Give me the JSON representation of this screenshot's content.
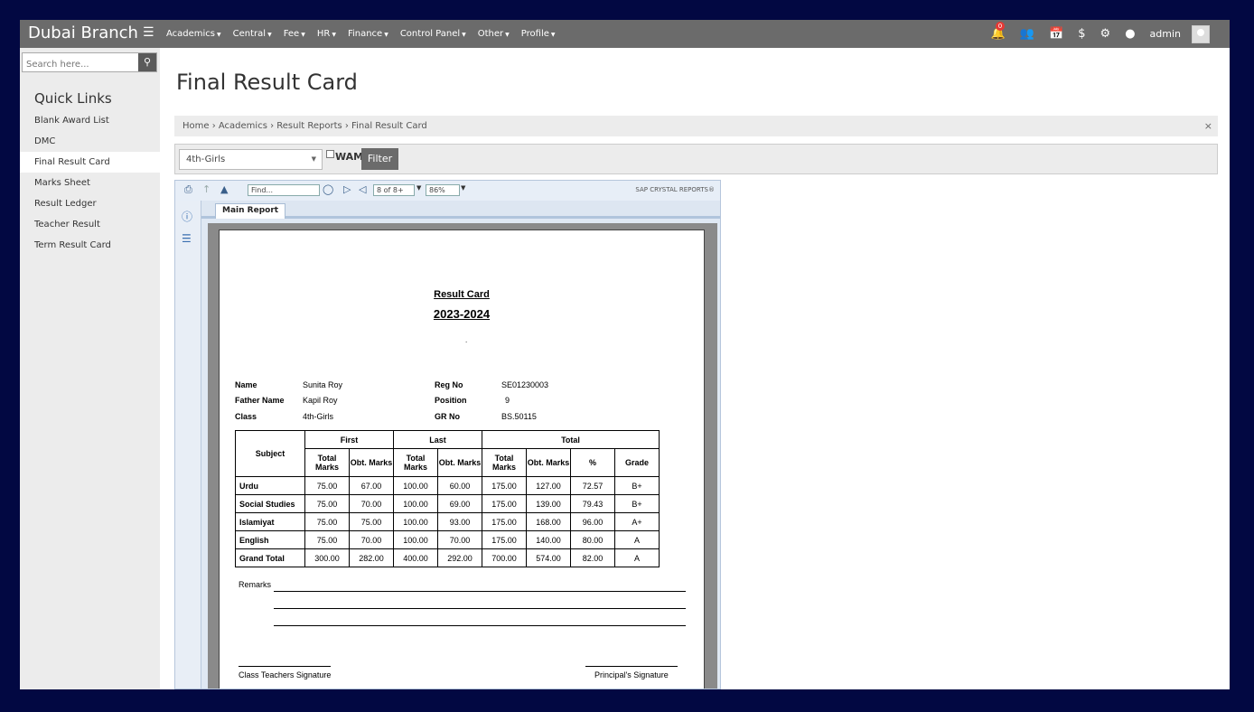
{
  "brand": "Dubai Branch",
  "nav": [
    "Academics",
    "Central",
    "Fee",
    "HR",
    "Finance",
    "Control Panel",
    "Other",
    "Profile"
  ],
  "notification_count": "0",
  "user": "admin",
  "icons": [
    "menu-icon",
    "bell-icon",
    "users-icon",
    "calendar-icon",
    "dollar-icon",
    "gear-icon",
    "drop-icon",
    "search-icon",
    "close-icon"
  ],
  "search": {
    "placeholder": "Search here..."
  },
  "quick_links": {
    "title": "Quick Links",
    "items": [
      "Blank Award List",
      "DMC",
      "Final Result Card",
      "Marks Sheet",
      "Result Ledger",
      "Teacher Result",
      "Term Result Card"
    ],
    "active": "Final Result Card"
  },
  "page_title": "Final Result Card",
  "breadcrumb": {
    "text": "Home › Academics › Result Reports › Final Result Card",
    "close": "×"
  },
  "filter": {
    "class_value": "4th-Girls",
    "wam_label": "WAM",
    "button": "Filter"
  },
  "viewer": {
    "find_placeholder": "Find...",
    "page_value": "8 of 8+",
    "zoom_value": "86%",
    "brand": "SAP CRYSTAL REPORTS®",
    "tab": "Main Report"
  },
  "report": {
    "title": "Result Card",
    "year": "2023-2024",
    "dot": ".",
    "name_label": "Name",
    "name": "Sunita Roy",
    "father_label": "Father Name",
    "father": "Kapil Roy",
    "class_label": "Class",
    "class": "4th-Girls",
    "reg_label": "Reg No",
    "reg": "SE01230003",
    "position_label": "Position",
    "position": "9",
    "gr_label": "GR No",
    "gr": "BS.50115",
    "headers": {
      "subject": "Subject",
      "first": "First",
      "last": "Last",
      "total": "Total",
      "total_marks": "Total Marks",
      "obt_marks": "Obt. Marks",
      "percent": "%",
      "grade": "Grade"
    },
    "rows": [
      [
        "Urdu",
        "75.00",
        "67.00",
        "100.00",
        "60.00",
        "175.00",
        "127.00",
        "72.57",
        "B+"
      ],
      [
        "Social Studies",
        "75.00",
        "70.00",
        "100.00",
        "69.00",
        "175.00",
        "139.00",
        "79.43",
        "B+"
      ],
      [
        "Islamiyat",
        "75.00",
        "75.00",
        "100.00",
        "93.00",
        "175.00",
        "168.00",
        "96.00",
        "A+"
      ],
      [
        "English",
        "75.00",
        "70.00",
        "100.00",
        "70.00",
        "175.00",
        "140.00",
        "80.00",
        "A"
      ],
      [
        "Grand Total",
        "300.00",
        "282.00",
        "400.00",
        "292.00",
        "700.00",
        "574.00",
        "82.00",
        "A"
      ]
    ],
    "remarks_label": "Remarks",
    "class_teacher_sig": "Class Teachers Signature",
    "principal_sig": "Principal's Signature"
  }
}
